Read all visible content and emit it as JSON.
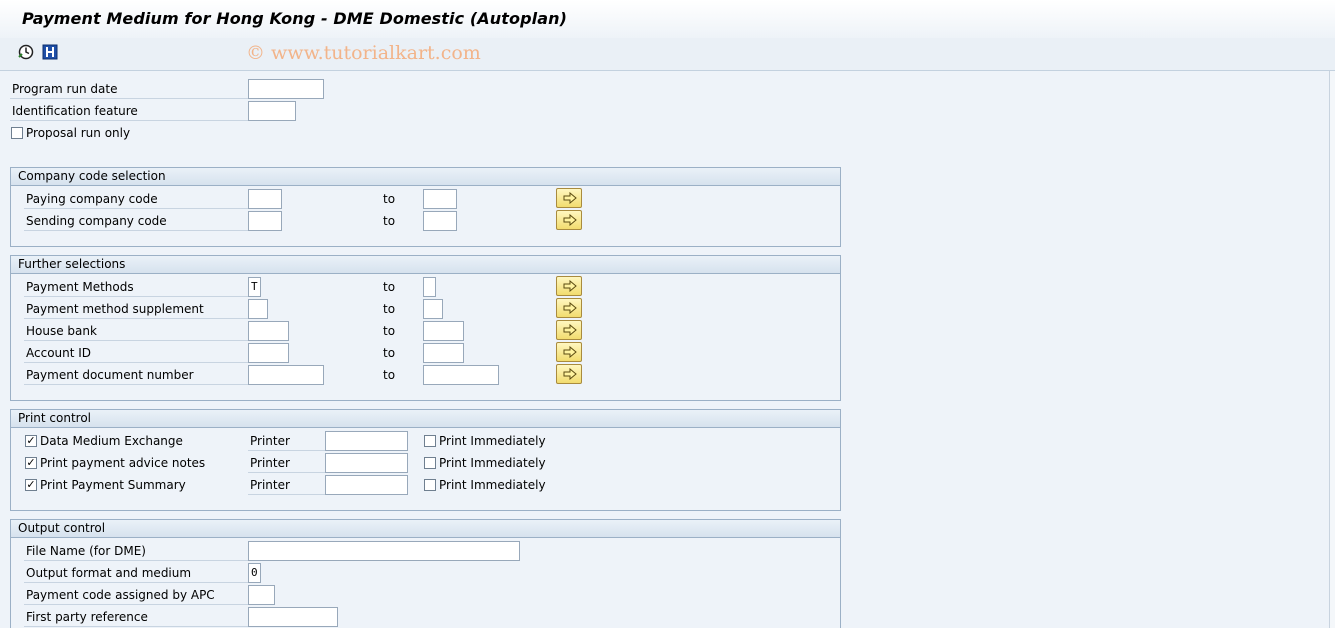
{
  "window": {
    "title": "Payment Medium for Hong Kong - DME Domestic (Autoplan)"
  },
  "toolbar": {
    "execute_icon": "execute-clock-icon",
    "info_icon": "info-icon"
  },
  "watermark": "© www.tutorialkart.com",
  "top_fields": {
    "program_run_date": {
      "label": "Program run date",
      "value": ""
    },
    "identification_feature": {
      "label": "Identification feature",
      "value": ""
    },
    "proposal_run_only": {
      "label": "Proposal run only",
      "checked": false
    }
  },
  "company_code_selection": {
    "title": "Company code selection",
    "to_label": "to",
    "rows": [
      {
        "label": "Paying company code",
        "from": "",
        "to": ""
      },
      {
        "label": "Sending company code",
        "from": "",
        "to": ""
      }
    ]
  },
  "further_selections": {
    "title": "Further selections",
    "to_label": "to",
    "rows": [
      {
        "label": "Payment Methods",
        "from": "T",
        "to": ""
      },
      {
        "label": "Payment method supplement",
        "from": "",
        "to": ""
      },
      {
        "label": "House bank",
        "from": "",
        "to": ""
      },
      {
        "label": "Account ID",
        "from": "",
        "to": ""
      },
      {
        "label": "Payment document number",
        "from": "",
        "to": ""
      }
    ]
  },
  "print_control": {
    "title": "Print control",
    "rows": [
      {
        "label": "Data Medium Exchange",
        "checked": true,
        "printer_label": "Printer",
        "printer": "",
        "immediately_label": "Print Immediately",
        "immediately": false
      },
      {
        "label": "Print payment advice notes",
        "checked": true,
        "printer_label": "Printer",
        "printer": "",
        "immediately_label": "Print Immediately",
        "immediately": false
      },
      {
        "label": "Print Payment Summary",
        "checked": true,
        "printer_label": "Printer",
        "printer": "",
        "immediately_label": "Print Immediately",
        "immediately": false
      }
    ]
  },
  "output_control": {
    "title": "Output control",
    "rows": [
      {
        "label": "File Name (for DME)",
        "value": ""
      },
      {
        "label": "Output format and medium",
        "value": "0"
      },
      {
        "label": "Payment code assigned by APC",
        "value": ""
      },
      {
        "label": "First party reference",
        "value": ""
      }
    ]
  },
  "colors": {
    "background": "#eef3f9",
    "group_border": "#9bb0c6",
    "button_yellow": "#f2dc6f",
    "watermark": "#f2b48a"
  }
}
